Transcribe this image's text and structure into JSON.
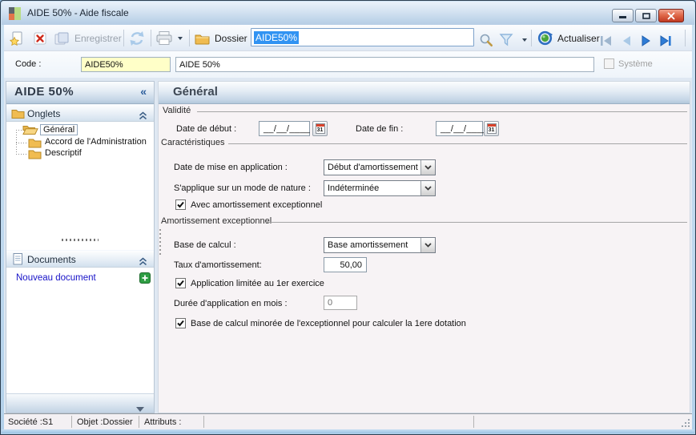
{
  "window": {
    "title": "AIDE 50% -  Aide fiscale"
  },
  "toolbar": {
    "save_label": "Enregistrer",
    "dossier_label": "Dossier",
    "search_value": "AIDE50%",
    "actualiser_label": "Actualiser"
  },
  "code_row": {
    "code_label": "Code :",
    "code_value": "AIDE50%",
    "name_value": "AIDE 50%",
    "system_label": "Système"
  },
  "sidebar": {
    "title": "AIDE 50%",
    "collapse_glyph": "«",
    "onglets_label": "Onglets",
    "tabs": [
      "Général",
      "Accord de l'Administration",
      "Descriptif"
    ],
    "documents_label": "Documents",
    "new_document_label": "Nouveau document"
  },
  "main": {
    "title": "Général",
    "validity": {
      "label": "Validité",
      "date_start_label": "Date de début :",
      "date_start_value": "__/__/____",
      "date_end_label": "Date de fin :",
      "date_end_value": "__/__/____",
      "calendar_day": "31"
    },
    "characteristics": {
      "label": "Caractéristiques",
      "application_date_label": "Date de mise en application :",
      "application_date_value": "Début d'amortissement",
      "nature_mode_label": "S'applique sur un mode de nature :",
      "nature_mode_value": "Indéterminée",
      "exceptional_label": "Avec amortissement exceptionnel",
      "exceptional_checked": true
    },
    "exceptional": {
      "label": "Amortissement exceptionnel",
      "base_label": "Base de calcul :",
      "base_value": "Base amortissement",
      "rate_label": "Taux d'amortissement:",
      "rate_value": "50,00",
      "first_year_label": "Application limitée au 1er exercice",
      "first_year_checked": true,
      "duration_label": "Durée d'application en mois :",
      "duration_value": "0",
      "minored_label": "Base de calcul minorée de l'exceptionnel pour calculer la 1ere dotation",
      "minored_checked": true
    }
  },
  "statusbar": {
    "societe": "Société :S1",
    "objet": "Objet :Dossier",
    "attributs": "Attributs :"
  }
}
